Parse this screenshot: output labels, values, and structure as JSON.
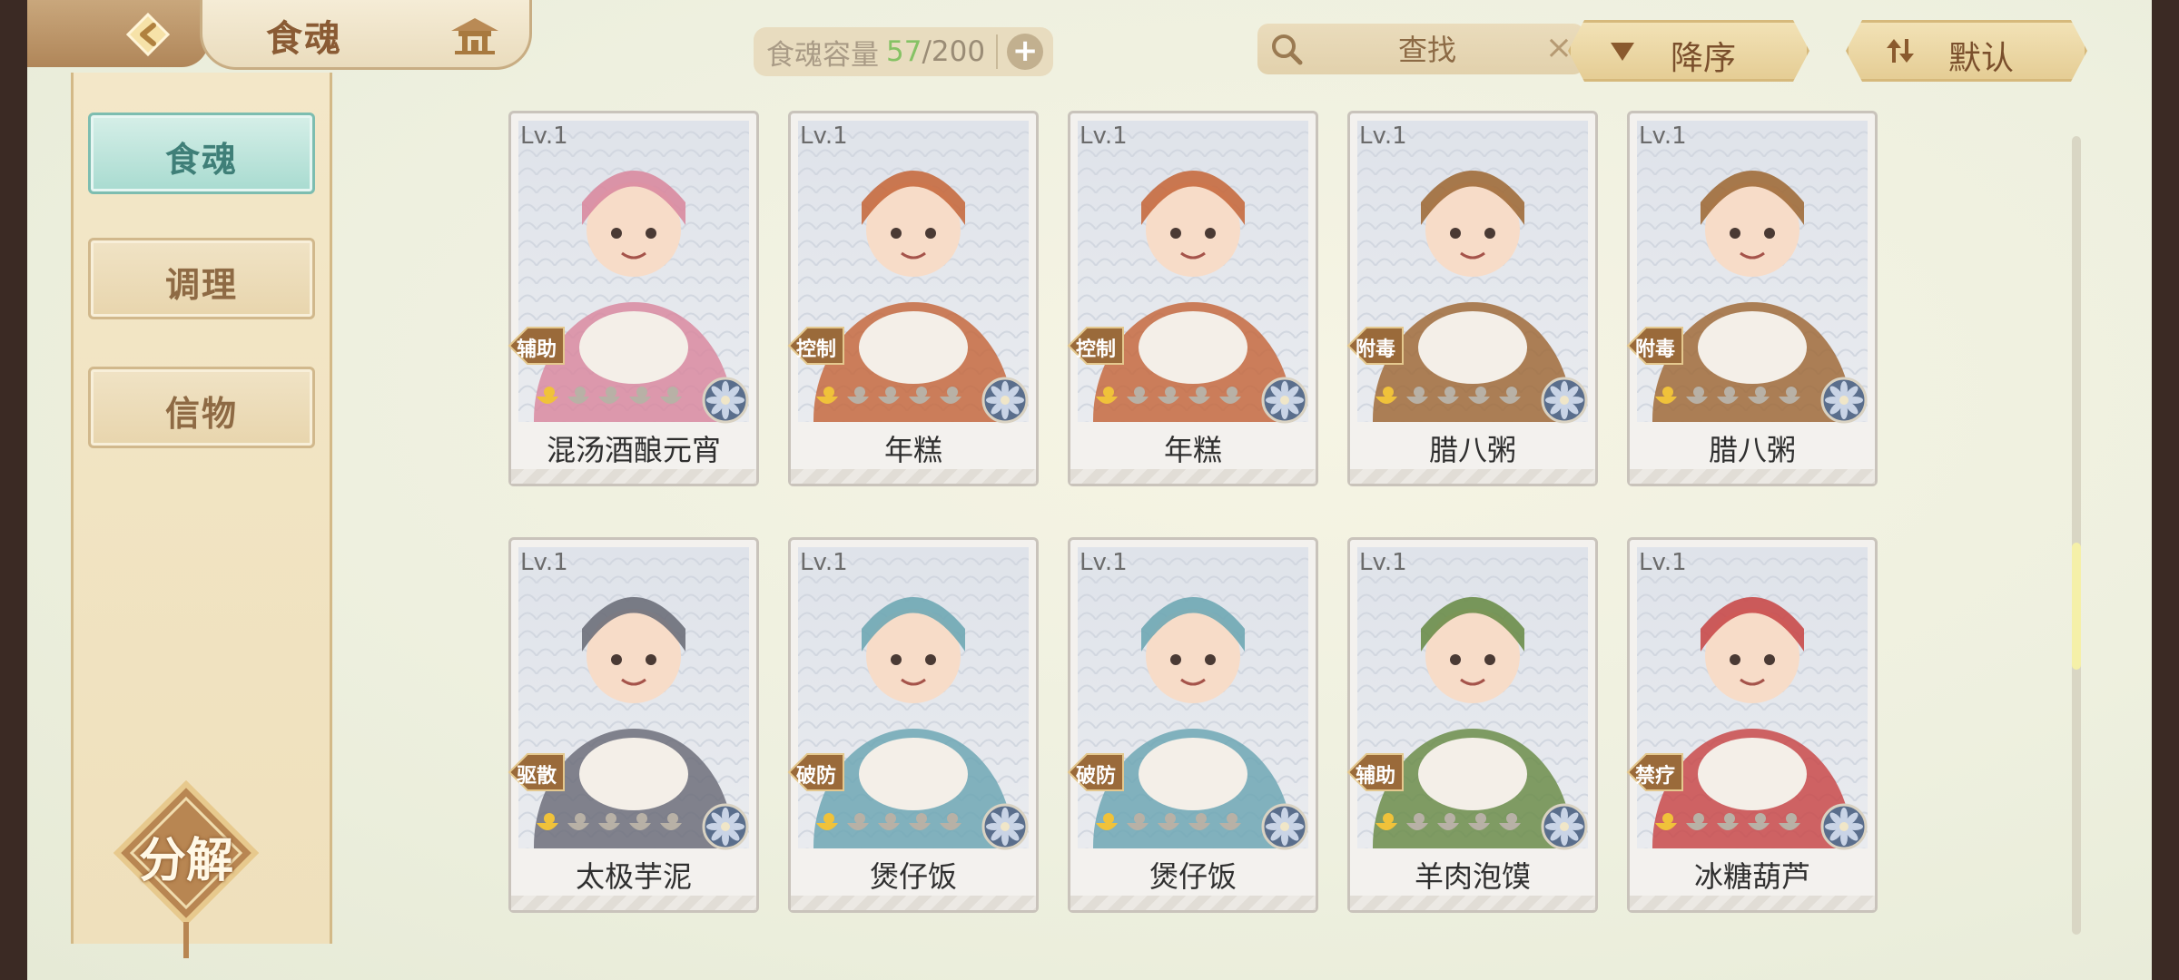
{
  "header": {
    "title": "食魂",
    "back_icon": "back-arrow-icon",
    "home_icon": "pavilion-icon"
  },
  "capacity": {
    "label": "食魂容量",
    "current": "57",
    "separator": "/",
    "max": "200",
    "plus": "+"
  },
  "search": {
    "placeholder": "查找",
    "clear": "×"
  },
  "sort": {
    "order_label": "降序",
    "mode_label": "默认"
  },
  "sidebar": {
    "items": [
      {
        "label": "食魂",
        "active": true
      },
      {
        "label": "调理",
        "active": false
      },
      {
        "label": "信物",
        "active": false
      }
    ],
    "decompose_label": "分解"
  },
  "cards": [
    {
      "level": "Lv.1",
      "role": "辅助",
      "name": "混汤酒酿元宵"
    },
    {
      "level": "Lv.1",
      "role": "控制",
      "name": "年糕"
    },
    {
      "level": "Lv.1",
      "role": "控制",
      "name": "年糕"
    },
    {
      "level": "Lv.1",
      "role": "附毒",
      "name": "腊八粥"
    },
    {
      "level": "Lv.1",
      "role": "附毒",
      "name": "腊八粥"
    },
    {
      "level": "Lv.1",
      "role": "驱散",
      "name": "太极芋泥"
    },
    {
      "level": "Lv.1",
      "role": "破防",
      "name": "煲仔饭"
    },
    {
      "level": "Lv.1",
      "role": "破防",
      "name": "煲仔饭"
    },
    {
      "level": "Lv.1",
      "role": "辅助",
      "name": "羊肉泡馍"
    },
    {
      "level": "Lv.1",
      "role": "禁疗",
      "name": "冰糖葫芦"
    }
  ],
  "colors": {
    "accent_teal": "#a8dbd0",
    "badge_brown": "#9a6a3a",
    "capacity_green": "#86c265"
  }
}
